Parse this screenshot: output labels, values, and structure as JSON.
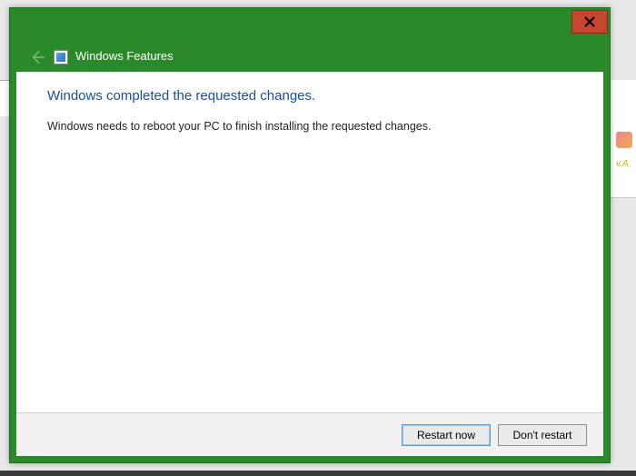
{
  "window": {
    "title": "Windows Features"
  },
  "content": {
    "heading": "Windows completed the requested changes.",
    "message": "Windows needs to reboot your PC to finish installing the requested changes."
  },
  "buttons": {
    "restart_now": "Restart now",
    "dont_restart": "Don't restart"
  },
  "backdrop": {
    "fragment": "v.A"
  }
}
